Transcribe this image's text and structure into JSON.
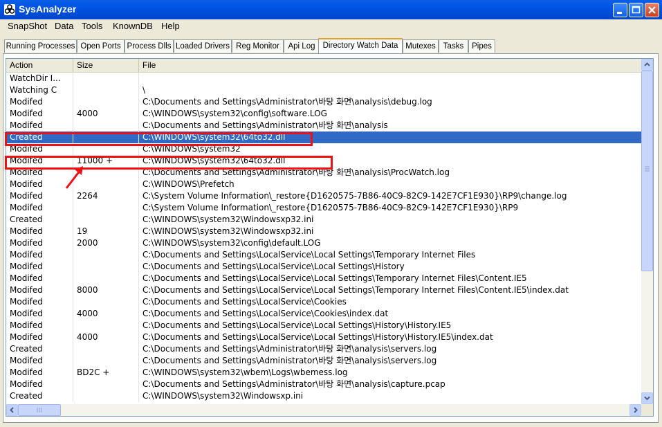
{
  "window": {
    "title": "SysAnalyzer"
  },
  "menu": [
    "SnapShot",
    "Data",
    "Tools",
    "KnownDB",
    "Help"
  ],
  "tabs": [
    "Running Processes",
    "Open Ports",
    "Process Dlls",
    "Loaded Drivers",
    "Reg Monitor",
    "Api Log",
    "Directory Watch Data",
    "Mutexes",
    "Tasks",
    "Pipes"
  ],
  "active_tab": "Directory Watch Data",
  "columns": [
    "Action",
    "Size",
    "File"
  ],
  "rows": [
    [
      "WatchDir I...",
      "",
      ""
    ],
    [
      "Watching C",
      "",
      "\\"
    ],
    [
      "Modifed",
      "",
      "C:\\Documents and Settings\\Administrator\\바탕 화면\\analysis\\debug.log"
    ],
    [
      "Modifed",
      "4000",
      "C:\\WINDOWS\\system32\\config\\software.LOG"
    ],
    [
      "Modifed",
      "",
      "C:\\Documents and Settings\\Administrator\\바탕 화면\\analysis"
    ],
    [
      "Created",
      "",
      "C:\\WINDOWS\\system32\\64to32.dll"
    ],
    [
      "Modifed",
      "",
      "C:\\WINDOWS\\system32"
    ],
    [
      "Modifed",
      "11000 +",
      "C:\\WINDOWS\\system32\\64to32.dll"
    ],
    [
      "Modifed",
      "",
      "C:\\Documents and Settings\\Administrator\\바탕 화면\\analysis\\ProcWatch.log"
    ],
    [
      "Modifed",
      "",
      "C:\\WINDOWS\\Prefetch"
    ],
    [
      "Modifed",
      "2264",
      "C:\\System Volume Information\\_restore{D1620575-7B86-40C9-82C9-142E7CF1E930}\\RP9\\change.log"
    ],
    [
      "Modifed",
      "",
      "C:\\System Volume Information\\_restore{D1620575-7B86-40C9-82C9-142E7CF1E930}\\RP9"
    ],
    [
      "Created",
      "",
      "C:\\WINDOWS\\system32\\Windowsxp32.ini"
    ],
    [
      "Modifed",
      "19",
      "C:\\WINDOWS\\system32\\Windowsxp32.ini"
    ],
    [
      "Modifed",
      "2000",
      "C:\\WINDOWS\\system32\\config\\default.LOG"
    ],
    [
      "Modifed",
      "",
      "C:\\Documents and Settings\\LocalService\\Local Settings\\Temporary Internet Files"
    ],
    [
      "Modifed",
      "",
      "C:\\Documents and Settings\\LocalService\\Local Settings\\History"
    ],
    [
      "Modifed",
      "",
      "C:\\Documents and Settings\\LocalService\\Local Settings\\Temporary Internet Files\\Content.IE5"
    ],
    [
      "Modifed",
      "8000",
      "C:\\Documents and Settings\\LocalService\\Local Settings\\Temporary Internet Files\\Content.IE5\\index.dat"
    ],
    [
      "Modifed",
      "",
      "C:\\Documents and Settings\\LocalService\\Cookies"
    ],
    [
      "Modifed",
      "4000",
      "C:\\Documents and Settings\\LocalService\\Cookies\\index.dat"
    ],
    [
      "Modifed",
      "",
      "C:\\Documents and Settings\\LocalService\\Local Settings\\History\\History.IE5"
    ],
    [
      "Modifed",
      "4000",
      "C:\\Documents and Settings\\LocalService\\Local Settings\\History\\History.IE5\\index.dat"
    ],
    [
      "Created",
      "",
      "C:\\Documents and Settings\\Administrator\\바탕 화면\\analysis\\servers.log"
    ],
    [
      "Modifed",
      "",
      "C:\\Documents and Settings\\Administrator\\바탕 화면\\analysis\\servers.log"
    ],
    [
      "Modifed",
      "BD2C +",
      "C:\\WINDOWS\\system32\\wbem\\Logs\\wbemess.log"
    ],
    [
      "Modifed",
      "",
      "C:\\Documents and Settings\\Administrator\\바탕 화면\\analysis\\capture.pcap"
    ],
    [
      "Created",
      "",
      "C:\\WINDOWS\\system32\\Windowsxp.ini"
    ]
  ],
  "selected_row": 5,
  "annotation_color": "#ee1111"
}
